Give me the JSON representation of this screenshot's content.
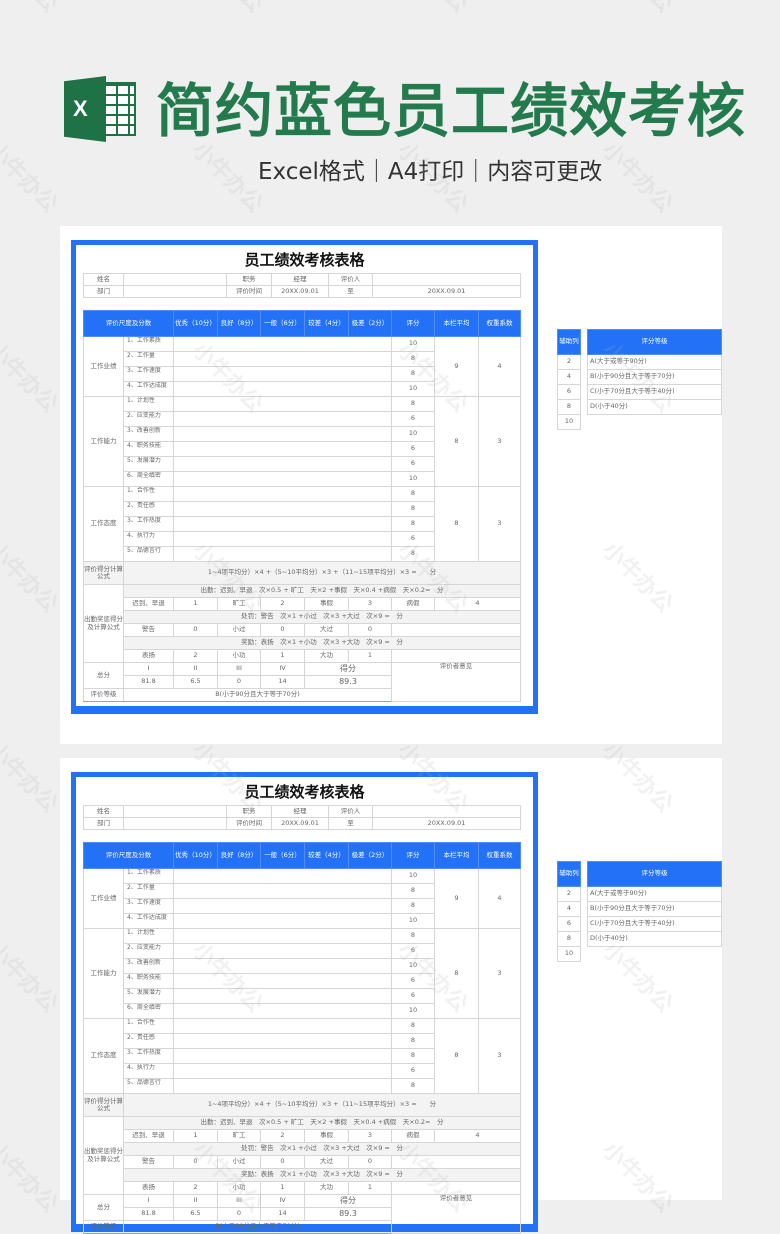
{
  "banner": {
    "icon": "excel-icon",
    "icon_letter": "X",
    "title": "简约蓝色员工绩效考核",
    "subtitle": "Excel格式｜A4打印｜内容可更改",
    "title_color": "#237a4d"
  },
  "colors": {
    "accent": "#2271f6",
    "frame_border": "#7aa6f2",
    "background": "#efefef"
  },
  "sheet": {
    "title": "员工绩效考核表格",
    "info": {
      "name_label": "姓名",
      "name_value": "",
      "position_label": "职务",
      "position_value": "经理",
      "evaluator_label": "评价人",
      "evaluator_value": "",
      "dept_label": "部门",
      "dept_value": "",
      "period_label": "评价时间",
      "period_start": "20XX.09.01",
      "to_label": "至",
      "period_end": "20XX.09.01"
    },
    "headers": [
      "评价尺度及分数",
      "优秀（10分）",
      "良好（8分）",
      "一般（6分）",
      "较差（4分）",
      "极差（2分）",
      "评分",
      "本栏平均",
      "权重系数"
    ],
    "categories": [
      {
        "name": "工作业绩",
        "average": "9",
        "weight": "4",
        "items": [
          {
            "label": "1、工作素质",
            "score": "10"
          },
          {
            "label": "2、工作量",
            "score": "8"
          },
          {
            "label": "3、工作速度",
            "score": "8"
          },
          {
            "label": "4、工作达成度",
            "score": "10"
          }
        ]
      },
      {
        "name": "工作能力",
        "average": "8",
        "weight": "3",
        "items": [
          {
            "label": "1、计划性",
            "score": "8"
          },
          {
            "label": "2、应变能力",
            "score": "6"
          },
          {
            "label": "3、改善创新",
            "score": "10"
          },
          {
            "label": "4、职务技能",
            "score": "6"
          },
          {
            "label": "5、发展潜力",
            "score": "6"
          },
          {
            "label": "6、周全缜密",
            "score": "10"
          }
        ]
      },
      {
        "name": "工作态度",
        "average": "8",
        "weight": "3",
        "items": [
          {
            "label": "1、合作性",
            "score": "8"
          },
          {
            "label": "2、责任感",
            "score": "8"
          },
          {
            "label": "3、工作热度",
            "score": "8"
          },
          {
            "label": "4、执行力",
            "score": "6"
          },
          {
            "label": "5、品德言行",
            "score": "8"
          }
        ]
      }
    ],
    "formula": {
      "label": "评价得分计算公式",
      "text": "1~4项平均分）×4 +（5~10平均分）×3 +（11~15项平均分）×3 =　　分"
    },
    "attendance": {
      "label": "出勤奖惩得分及计算公式",
      "attendance_formula": "出勤：迟到、早退　次×0.5 + 旷工　天×2 +事假　天×0.4 +病假　天×0.2=　分",
      "attendance_values": [
        "迟到、早退",
        "1",
        "旷工",
        "2",
        "事假",
        "3",
        "病假",
        "4"
      ],
      "penalty_formula": "处罚：警告　次×1 +小过　次×3 +大过　次×9 =　分",
      "penalty_values": [
        "警告",
        "0",
        "小过",
        "0",
        "大过",
        "0"
      ],
      "reward_formula": "奖励：表扬　次×1 +小功　次×3 +大功　次×9 =　分",
      "reward_values": [
        "表扬",
        "2",
        "小功",
        "1",
        "大功",
        "1"
      ]
    },
    "total": {
      "label": "总分",
      "columns": [
        "I",
        "II",
        "III",
        "IV",
        "得分"
      ],
      "values": [
        "81.8",
        "6.5",
        "0",
        "14",
        "89.3"
      ],
      "comment_label": "评价者意见"
    },
    "grade_row": {
      "label": "评价等级",
      "value": "B(小于90分且大于等于70分)"
    },
    "aux": {
      "header": "辅助列",
      "values": [
        "2",
        "4",
        "6",
        "8",
        "10"
      ]
    },
    "grade_table": {
      "header": "评分等级",
      "values": [
        "A(大于或等于90分)",
        "B(小于90分且大于等于70分)",
        "C(小于70分且大于等于40分)",
        "D(小于40分)"
      ]
    }
  },
  "watermark": "小牛办公"
}
